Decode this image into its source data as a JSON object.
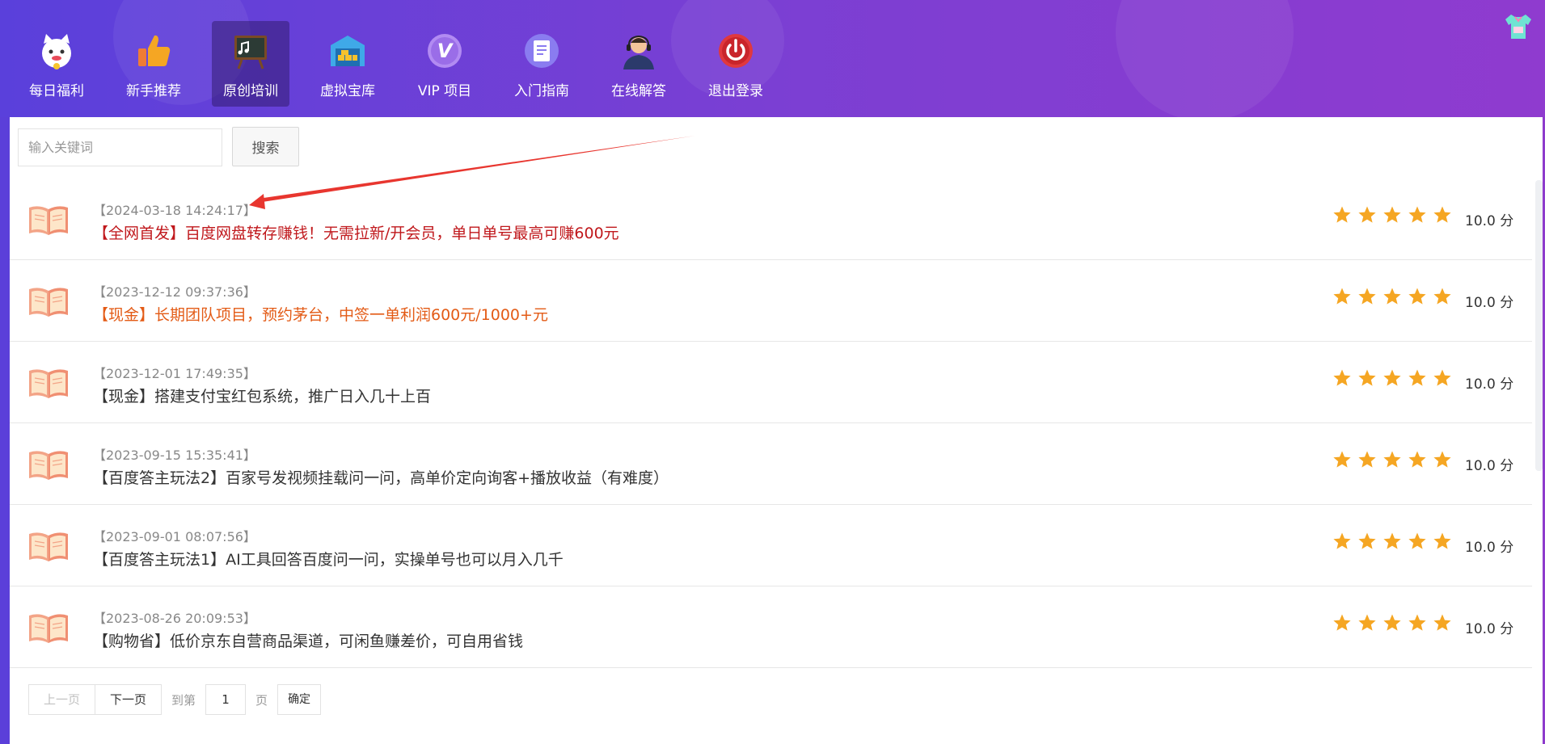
{
  "nav": {
    "items": [
      {
        "label": "每日福利",
        "icon": "lucky-cat-icon",
        "active": false
      },
      {
        "label": "新手推荐",
        "icon": "thumbs-up-icon",
        "active": false
      },
      {
        "label": "原创培训",
        "icon": "blackboard-icon",
        "active": true
      },
      {
        "label": "虚拟宝库",
        "icon": "warehouse-icon",
        "active": false
      },
      {
        "label": "VIP 项目",
        "icon": "vip-icon",
        "active": false
      },
      {
        "label": "入门指南",
        "icon": "document-icon",
        "active": false
      },
      {
        "label": "在线解答",
        "icon": "support-agent-icon",
        "active": false
      },
      {
        "label": "退出登录",
        "icon": "power-icon",
        "active": false
      }
    ]
  },
  "search": {
    "placeholder": "输入关键词",
    "value": "",
    "button_label": "搜索"
  },
  "articles": [
    {
      "date": "【2024-03-18 14:24:17】",
      "title": "【全网首发】百度网盘转存赚钱！无需拉新/开会员，单日单号最高可赚600元",
      "color": "#c0181c",
      "rating": 5,
      "score": "10.0 分"
    },
    {
      "date": "【2023-12-12 09:37:36】",
      "title": "【现金】长期团队项目，预约茅台，中签一单利润600元/1000+元",
      "color": "#e35b16",
      "rating": 5,
      "score": "10.0 分"
    },
    {
      "date": "【2023-12-01 17:49:35】",
      "title": "【现金】搭建支付宝红包系统，推广日入几十上百",
      "color": "#333333",
      "rating": 5,
      "score": "10.0 分"
    },
    {
      "date": "【2023-09-15 15:35:41】",
      "title": "【百度答主玩法2】百家号发视频挂载问一问，高单价定向询客+播放收益（有难度）",
      "color": "#333333",
      "rating": 5,
      "score": "10.0 分"
    },
    {
      "date": "【2023-09-01 08:07:56】",
      "title": "【百度答主玩法1】AI工具回答百度问一问，实操单号也可以月入几千",
      "color": "#333333",
      "rating": 5,
      "score": "10.0 分"
    },
    {
      "date": "【2023-08-26 20:09:53】",
      "title": "【购物省】低价京东自营商品渠道，可闲鱼赚差价，可自用省钱",
      "color": "#333333",
      "rating": 5,
      "score": "10.0 分"
    }
  ],
  "pagination": {
    "prev_label": "上一页",
    "next_label": "下一页",
    "goto_label": "到第",
    "page_value": "1",
    "page_unit": "页",
    "confirm_label": "确定"
  },
  "colors": {
    "header_start": "#5a40db",
    "header_end": "#8f3bcf",
    "star": "#f5a623",
    "annotation_arrow": "#e8362f"
  }
}
